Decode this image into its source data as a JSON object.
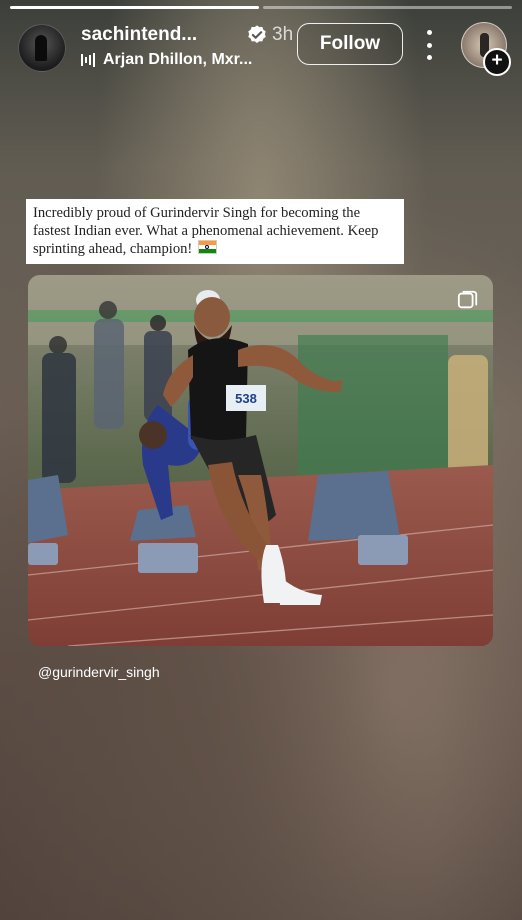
{
  "story": {
    "progress_segments": 2,
    "active_segment": 0
  },
  "header": {
    "username": "sachintend...",
    "time": "3h",
    "music": "Arjan Dhillon, Mxr...",
    "follow_label": "Follow",
    "verified": true
  },
  "post": {
    "caption": "Incredibly proud of Gurindervir Singh for becoming the fastest Indian ever. What a phenomenal achievement. Keep sprinting ahead, champion!",
    "bib_number": "538",
    "mention": "@gurindervir_singh"
  },
  "icons": {
    "verified": "verified-badge-icon",
    "music": "music-bars-icon",
    "more": "more-options-icon",
    "carousel": "multiple-images-icon",
    "flag": "india-flag-icon",
    "add": "plus-icon"
  },
  "colors": {
    "accent": "#0095f6",
    "track": "#8a4a3f",
    "caption_bg": "#ffffff"
  }
}
